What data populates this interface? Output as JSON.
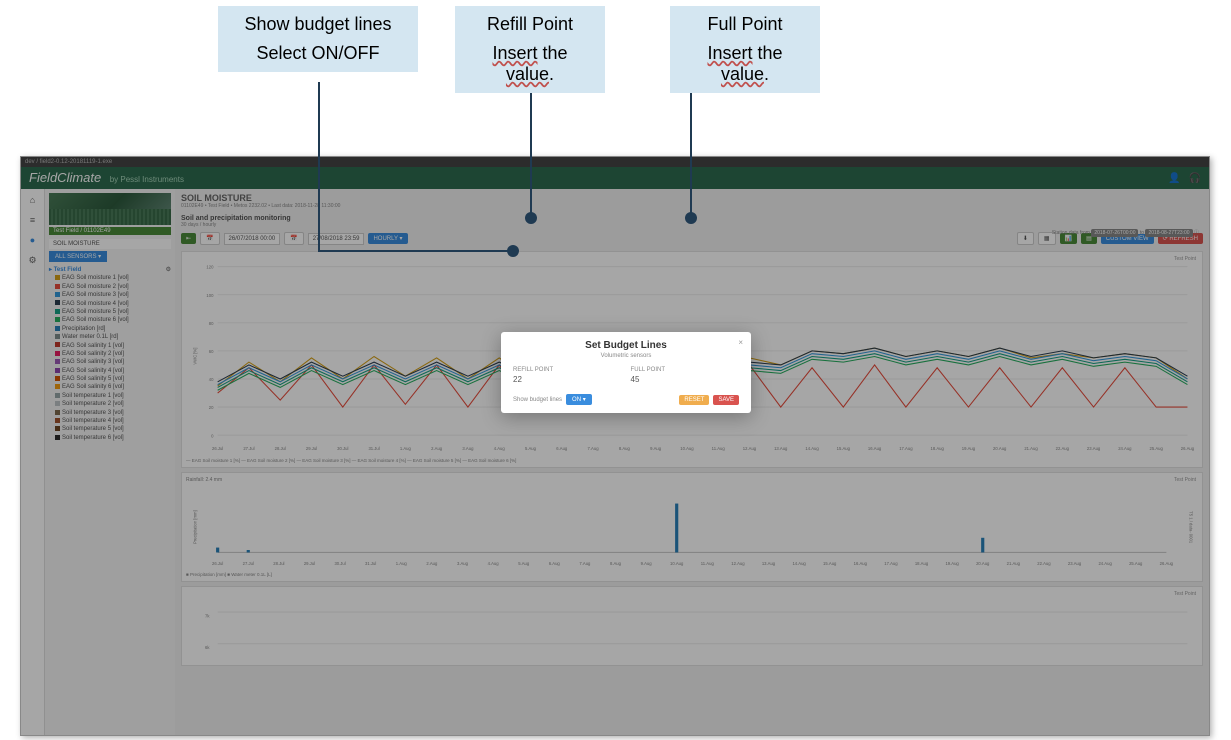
{
  "callouts": {
    "budget": {
      "line1": "Show budget lines",
      "line2": "Select ON/OFF"
    },
    "refill": {
      "title": "Refill Point",
      "insert": "Insert",
      "the": " the ",
      "value": "value",
      "dot": "."
    },
    "full": {
      "title": "Full Point",
      "insert": "Insert",
      "the": " the ",
      "value": "value",
      "dot": "."
    }
  },
  "browser": {
    "path": "dev / field2-0.12-20181119-1.exe"
  },
  "brand": {
    "name": "FieldClimate",
    "by": "by Pessl Instruments"
  },
  "sidebar": {
    "field_badge": "Test Field / 01102E49",
    "section": "SOIL MOISTURE",
    "sensors_btn": "ALL SENSORS ▾",
    "tree_header": "Test Field",
    "items": [
      {
        "c": "#d4a017",
        "t": "EAG Soil moisture 1 [vol]"
      },
      {
        "c": "#e74c3c",
        "t": "EAG Soil moisture 2 [vol]"
      },
      {
        "c": "#3498db",
        "t": "EAG Soil moisture 3 [vol]"
      },
      {
        "c": "#2c3e50",
        "t": "EAG Soil moisture 4 [vol]"
      },
      {
        "c": "#16a085",
        "t": "EAG Soil moisture 5 [vol]"
      },
      {
        "c": "#27ae60",
        "t": "EAG Soil moisture 6 [vol]"
      },
      {
        "c": "#2980b9",
        "t": "Precipitation [rd]"
      },
      {
        "c": "#7f8c8d",
        "t": "Water meter 0.1L [rd]"
      },
      {
        "c": "#c0392b",
        "t": "EAG Soil salinity 1 [vol]"
      },
      {
        "c": "#e91e63",
        "t": "EAG Soil salinity 2 [vol]"
      },
      {
        "c": "#9b59b6",
        "t": "EAG Soil salinity 3 [vol]"
      },
      {
        "c": "#8e44ad",
        "t": "EAG Soil salinity 4 [vol]"
      },
      {
        "c": "#d35400",
        "t": "EAG Soil salinity 5 [vol]"
      },
      {
        "c": "#f39c12",
        "t": "EAG Soil salinity 6 [vol]"
      },
      {
        "c": "#95a5a6",
        "t": "Soil temperature 1 [vol]"
      },
      {
        "c": "#bdc3c7",
        "t": "Soil temperature 2 [vol]"
      },
      {
        "c": "#7f6a4f",
        "t": "Soil temperature 3 [vol]"
      },
      {
        "c": "#a0522d",
        "t": "Soil temperature 4 [vol]"
      },
      {
        "c": "#6b4423",
        "t": "Soil temperature 5 [vol]"
      },
      {
        "c": "#2c2c2c",
        "t": "Soil temperature 6 [vol]"
      }
    ]
  },
  "content": {
    "title": "SOIL MOISTURE",
    "crumb": "01102E49 • Test Field • Metos 2232.02 • Last data: 2018-11-28 11:30:00",
    "section_title": "Soil and precipitation monitoring",
    "section_sub": "30 days / hourly",
    "date_from": "26/07/2018 00:00",
    "date_to": "27/08/2018 23:59",
    "hourly": "HOURLY ▾",
    "status_prefix": "Station data from",
    "status_d1": "2018-07-26T00:00",
    "status_to": "to",
    "status_d2": "2018-08-27T23:00",
    "custom_view": "CUSTOM VIEW",
    "refresh": "⟳ REFRESH",
    "test_point": "Test Point",
    "rainfall": "Rainfall: 2.4 mm",
    "legend1": "— EAG Soil moisture 1 [%]  — EAG Soil moisture 2 [%]  — EAG Soil moisture 3 [%]  — EAG Soil moisture 4 [%]  — EAG Soil moisture 5 [%]  — EAG Soil moisture 6 [%]",
    "legend2": "■ Precipitation [mm]  ■ Water meter 0.1L [L]",
    "ylabel1": "VWC [%]",
    "ylabel2": "Precipitation [mm]",
    "ylabel3": "T5 1 / data- 0001"
  },
  "modal": {
    "title": "Set Budget Lines",
    "subtitle": "Volumetric sensors",
    "refill_label": "REFILL POINT",
    "refill_value": "22",
    "full_label": "FULL POINT",
    "full_value": "45",
    "show_label": "Show budget lines",
    "toggle": "ON ▾",
    "reset": "RESET",
    "save": "SAVE"
  },
  "chart_data": [
    {
      "type": "line",
      "title": "Soil moisture",
      "ylabel": "VWC [%]",
      "ylim": [
        0,
        120
      ],
      "x": [
        "26.Jul",
        "27.Jul",
        "28.Jul",
        "29.Jul",
        "30.Jul",
        "31.Jul",
        "1.Aug",
        "2.Aug",
        "3.Aug",
        "4.Aug",
        "5.Aug",
        "6.Aug",
        "7.Aug",
        "8.Aug",
        "9.Aug",
        "10.Aug",
        "11.Aug",
        "12.Aug",
        "13.Aug",
        "14.Aug",
        "15.Aug",
        "16.Aug",
        "17.Aug",
        "18.Aug",
        "19.Aug",
        "20.Aug",
        "21.Aug",
        "22.Aug",
        "23.Aug",
        "24.Aug",
        "25.Aug",
        "26.Aug"
      ],
      "series": [
        {
          "name": "EAG Soil moisture 1",
          "color": "#d4a017",
          "values": [
            35,
            52,
            38,
            55,
            40,
            56,
            42,
            55,
            40,
            55,
            40,
            52,
            40,
            55,
            42,
            55,
            42,
            55,
            50,
            60,
            58,
            62,
            56,
            60,
            56,
            62,
            55,
            58,
            55,
            58,
            55,
            40
          ]
        },
        {
          "name": "EAG Soil moisture 2",
          "color": "#e74c3c",
          "values": [
            30,
            48,
            25,
            50,
            20,
            50,
            22,
            50,
            20,
            50,
            20,
            48,
            20,
            50,
            22,
            50,
            22,
            50,
            20,
            48,
            20,
            50,
            20,
            48,
            20,
            48,
            20,
            48,
            20,
            48,
            20,
            20
          ]
        },
        {
          "name": "EAG Soil moisture 3",
          "color": "#2c3e50",
          "values": [
            38,
            50,
            40,
            52,
            42,
            52,
            42,
            52,
            42,
            52,
            42,
            50,
            42,
            52,
            42,
            52,
            42,
            52,
            50,
            60,
            58,
            62,
            56,
            60,
            56,
            62,
            56,
            60,
            55,
            58,
            55,
            42
          ]
        },
        {
          "name": "EAG Soil moisture 4",
          "color": "#3498db",
          "values": [
            36,
            48,
            38,
            50,
            40,
            50,
            40,
            50,
            40,
            50,
            40,
            48,
            40,
            50,
            40,
            50,
            40,
            50,
            48,
            58,
            56,
            60,
            54,
            58,
            54,
            60,
            54,
            58,
            53,
            56,
            53,
            40
          ]
        },
        {
          "name": "EAG Soil moisture 5",
          "color": "#16a085",
          "values": [
            34,
            46,
            36,
            48,
            38,
            48,
            38,
            48,
            38,
            48,
            38,
            46,
            38,
            48,
            38,
            48,
            38,
            48,
            46,
            56,
            54,
            58,
            52,
            56,
            52,
            58,
            52,
            56,
            51,
            54,
            51,
            38
          ]
        },
        {
          "name": "EAG Soil moisture 6",
          "color": "#27ae60",
          "values": [
            32,
            44,
            34,
            46,
            36,
            46,
            36,
            46,
            36,
            46,
            36,
            44,
            36,
            46,
            36,
            46,
            36,
            46,
            44,
            54,
            52,
            56,
            50,
            54,
            50,
            56,
            50,
            54,
            49,
            52,
            49,
            36
          ]
        }
      ]
    },
    {
      "type": "bar",
      "title": "Rainfall",
      "ylabel": "Precipitation [mm]",
      "ylim": [
        0,
        2.5
      ],
      "x": [
        "26.Jul",
        "27.Jul",
        "28.Jul",
        "29.Jul",
        "30.Jul",
        "31.Jul",
        "1.Aug",
        "2.Aug",
        "3.Aug",
        "4.Aug",
        "5.Aug",
        "6.Aug",
        "7.Aug",
        "8.Aug",
        "9.Aug",
        "10.Aug",
        "11.Aug",
        "12.Aug",
        "13.Aug",
        "14.Aug",
        "15.Aug",
        "16.Aug",
        "17.Aug",
        "18.Aug",
        "19.Aug",
        "20.Aug",
        "21.Aug",
        "22.Aug",
        "23.Aug",
        "24.Aug",
        "25.Aug",
        "26.Aug"
      ],
      "series": [
        {
          "name": "Precipitation",
          "color": "#2980b9",
          "values": [
            0.2,
            0.1,
            0,
            0,
            0,
            0,
            0,
            0,
            0,
            0,
            0,
            0,
            0,
            0,
            0,
            2.0,
            0,
            0,
            0,
            0,
            0,
            0,
            0,
            0,
            0,
            0.6,
            0,
            0,
            0,
            0,
            0,
            0
          ]
        }
      ]
    }
  ]
}
